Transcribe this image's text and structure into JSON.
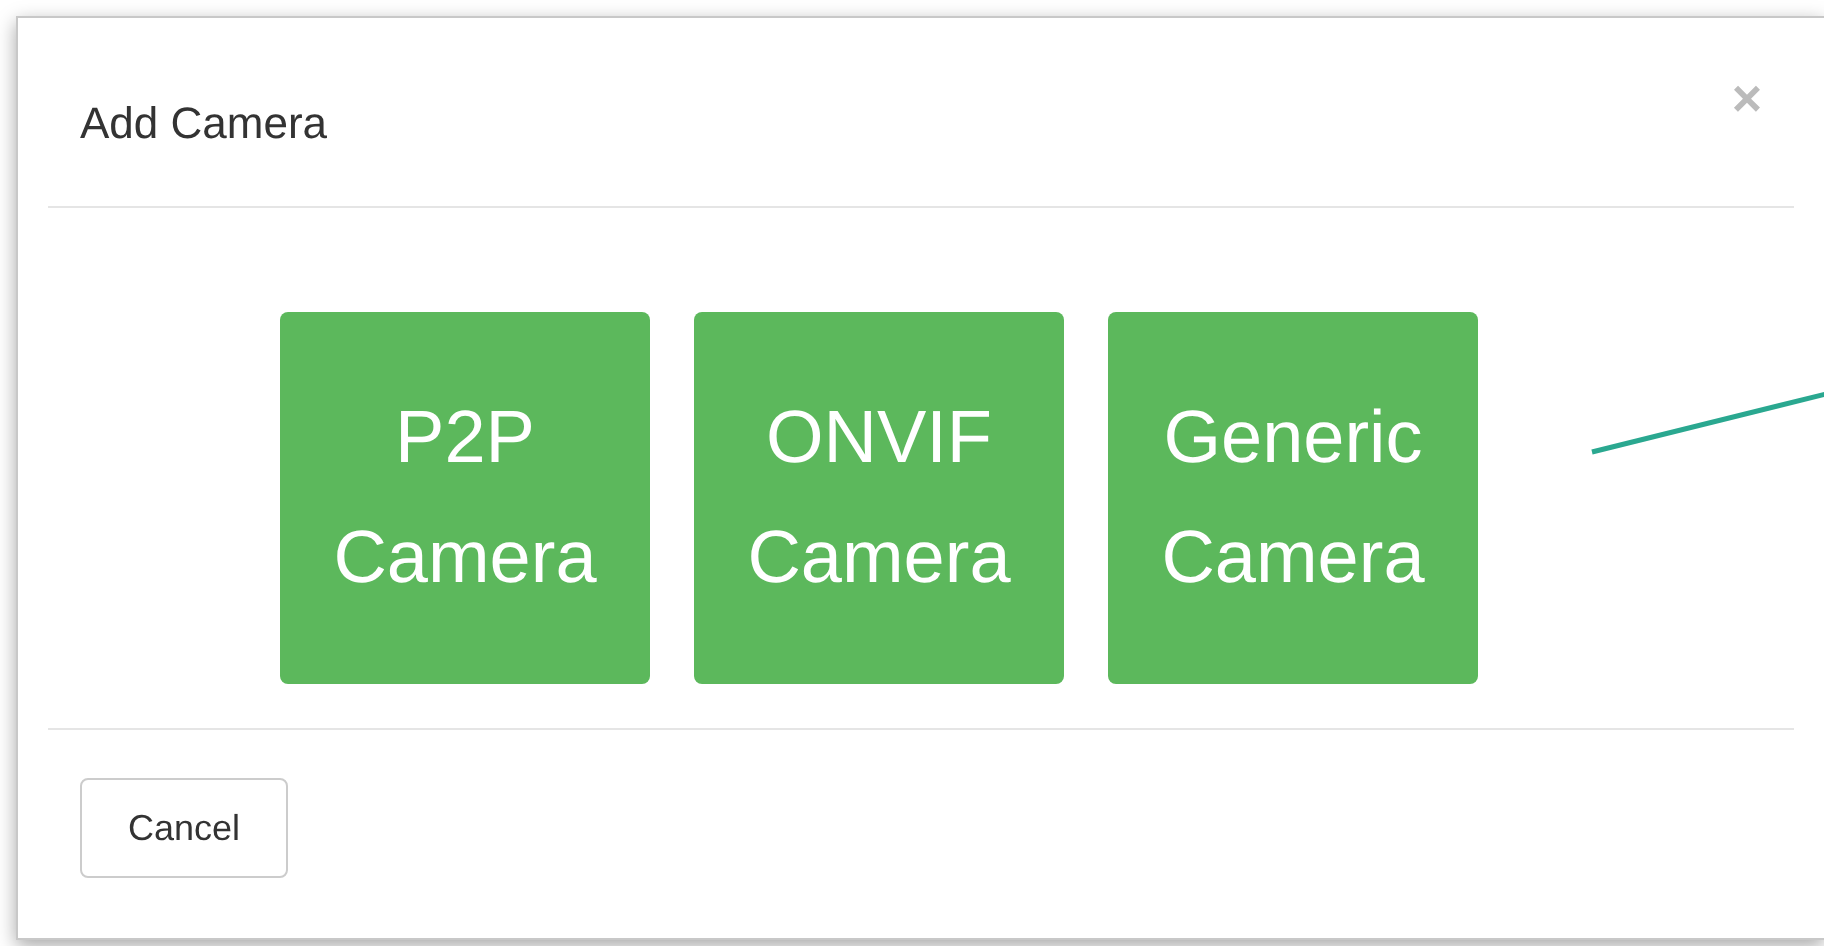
{
  "dialog": {
    "title": "Add Camera",
    "close": "×"
  },
  "options": [
    {
      "label": "P2P Camera"
    },
    {
      "label": "ONVIF Camera"
    },
    {
      "label": "Generic Camera"
    }
  ],
  "footer": {
    "buttons": [
      "Cancel"
    ]
  }
}
